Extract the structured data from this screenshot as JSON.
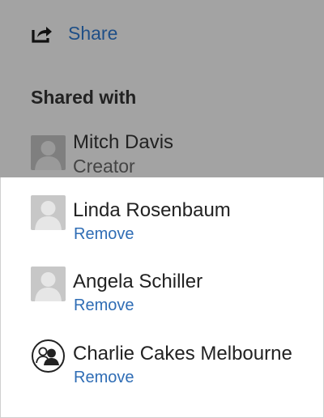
{
  "share": {
    "label": "Share",
    "icon": "share-icon"
  },
  "shared_with": {
    "title": "Shared with",
    "creator": {
      "name": "Mitch Davis",
      "role": "Creator",
      "avatar": "user-placeholder-icon"
    },
    "users": [
      {
        "name": "Linda Rosenbaum",
        "action": "Remove",
        "avatar": "user-placeholder-icon"
      },
      {
        "name": "Angela Schiller",
        "action": "Remove",
        "avatar": "user-placeholder-icon"
      },
      {
        "name": "Charlie Cakes Melbourne",
        "action": "Remove",
        "avatar": "group-icon"
      }
    ]
  },
  "colors": {
    "overlay": "#a3a3a3",
    "link": "#2f6db5",
    "share_link": "#1f4f87"
  }
}
